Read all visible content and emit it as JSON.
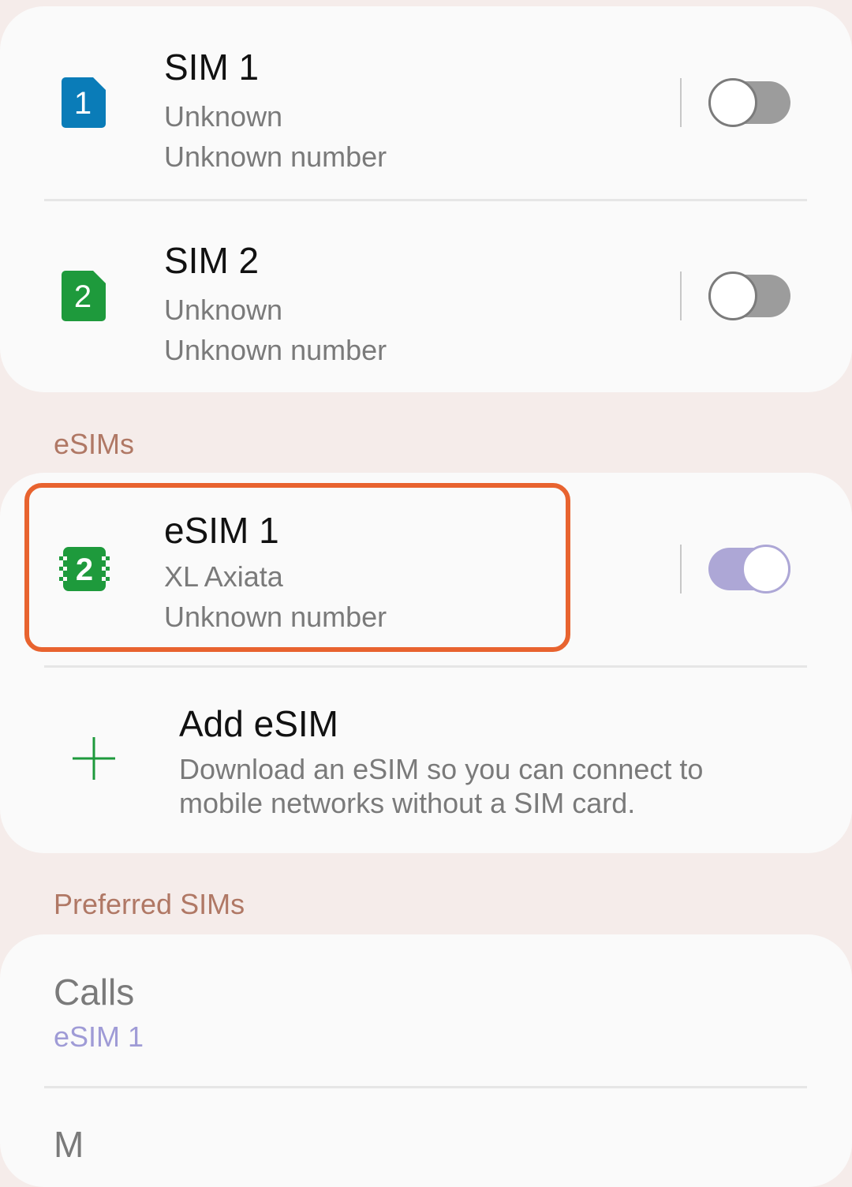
{
  "sims": [
    {
      "name": "SIM 1",
      "carrier": "Unknown",
      "number": "Unknown number",
      "slot": "1",
      "icon": "sim-1-icon",
      "color": "#0a7cb8",
      "enabled": false
    },
    {
      "name": "SIM 2",
      "carrier": "Unknown",
      "number": "Unknown number",
      "slot": "2",
      "icon": "sim-2-icon",
      "color": "#1e9a3c",
      "enabled": false
    }
  ],
  "esims_section": {
    "header": "eSIMs",
    "items": [
      {
        "name": "eSIM 1",
        "carrier": "XL Axiata",
        "number": "Unknown number",
        "slot": "2",
        "icon": "esim-chip-icon",
        "color": "#1e9a3c",
        "enabled": true,
        "highlighted": true
      }
    ],
    "add": {
      "title": "Add eSIM",
      "description_line1": "Download an eSIM so you can connect to",
      "description_line2": "mobile networks without a SIM card.",
      "icon": "plus-icon"
    }
  },
  "preferred_section": {
    "header": "Preferred SIMs",
    "calls": {
      "label": "Calls",
      "value": "eSIM 1"
    },
    "next_label_partial": "M"
  },
  "colors": {
    "background": "#f5ecea",
    "card": "#fafafa",
    "section_header": "#b07865",
    "toggle_on": "#ada7d6",
    "toggle_off": "#9c9c9c",
    "highlight": "#e8632f",
    "accent_value": "#9f9bd6"
  }
}
